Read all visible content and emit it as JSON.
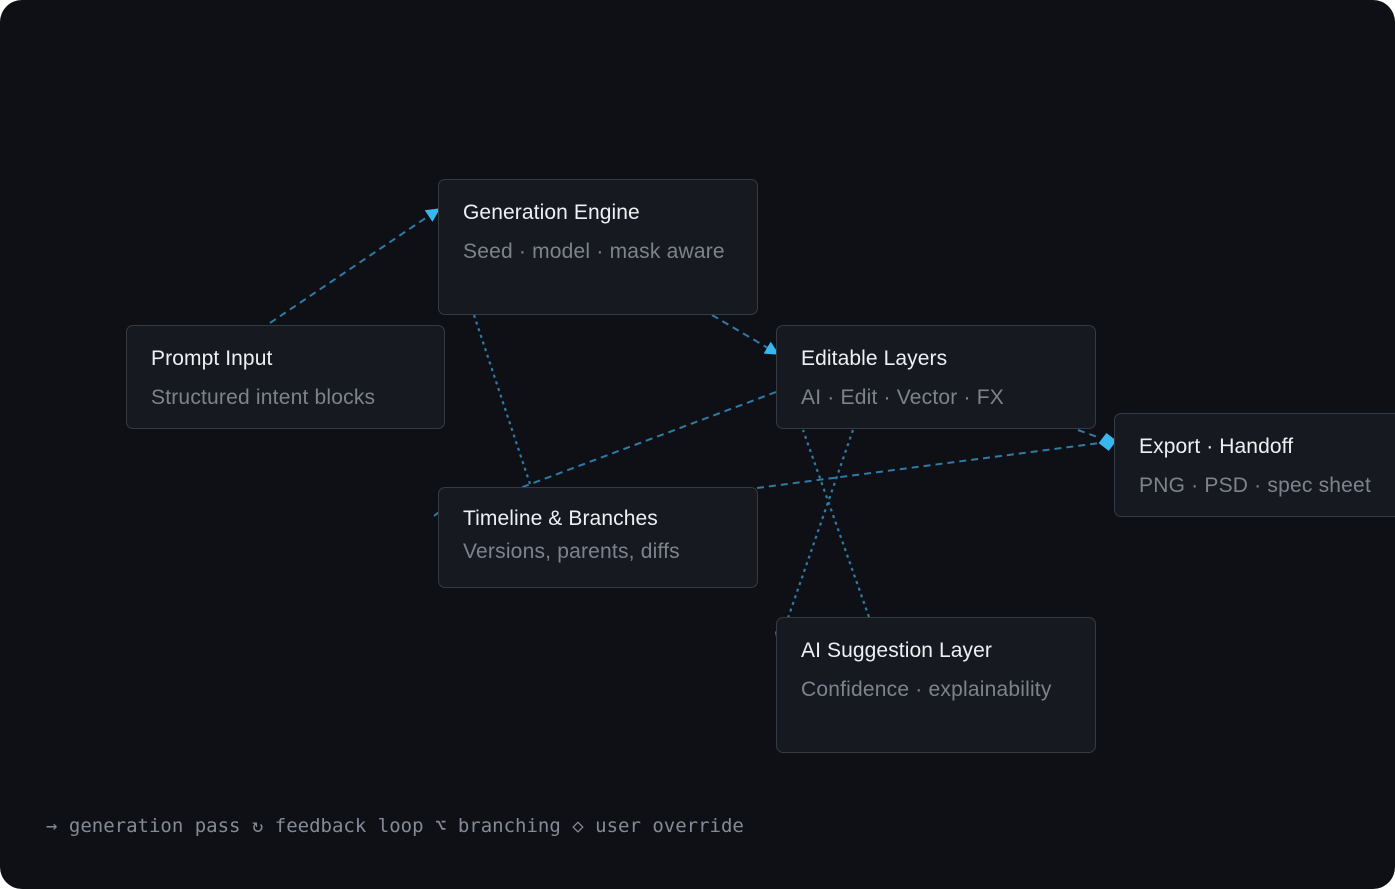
{
  "nodes": {
    "prompt": {
      "title": "Prompt Input",
      "subtitle": "Structured intent blocks"
    },
    "engine": {
      "title": "Generation Engine",
      "subtitle": "Seed · model · mask aware"
    },
    "layers": {
      "title": "Editable Layers",
      "subtitle": "AI · Edit · Vector · FX"
    },
    "export": {
      "title": "Export · Handoff",
      "subtitle": "PNG · PSD · spec sheet"
    },
    "timeline": {
      "title": "Timeline & Branches",
      "subtitle": "Versions, parents, diffs"
    },
    "suggestion": {
      "title": "AI Suggestion Layer",
      "subtitle": "Confidence · explainability"
    }
  },
  "legend": {
    "generation": "→ generation pass",
    "feedback": "↻ feedback loop",
    "branching": "⌥ branching",
    "override": "◇ user override"
  },
  "colors": {
    "background": "#0e1015",
    "node_fill": "#16191f",
    "node_border": "#353a43",
    "edge": "#2f7ba6",
    "arrow": "#38b6f0"
  }
}
